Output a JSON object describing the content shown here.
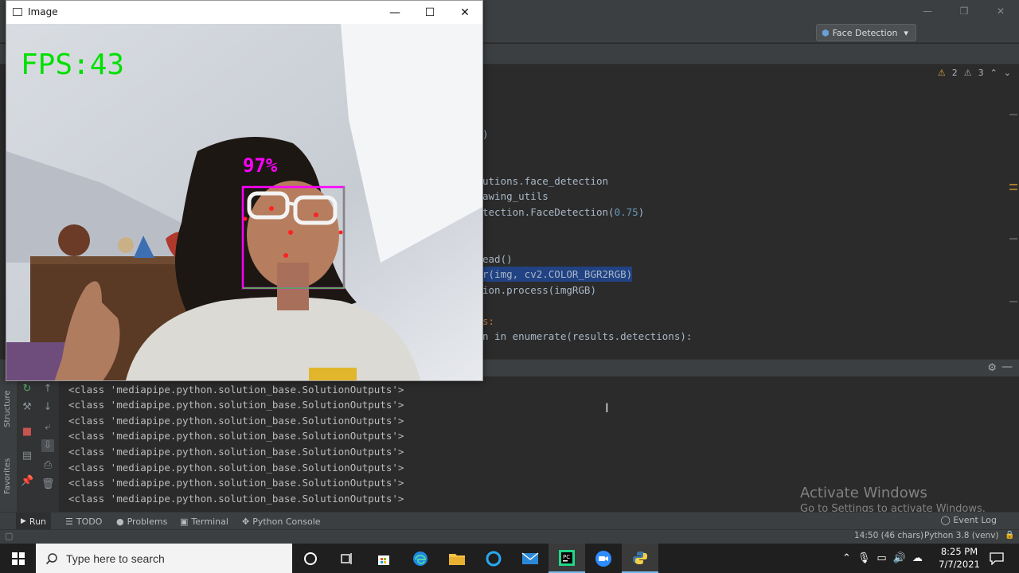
{
  "opencv_window": {
    "title": "Image",
    "fps_label": "FPS:43",
    "confidence_label": "97%",
    "controls": {
      "minimize": "—",
      "maximize": "☐",
      "close": "✕"
    }
  },
  "ide": {
    "run_config": "Face Detection",
    "inspections": {
      "warnings": "2",
      "weak_warnings": "3"
    },
    "code_lines": [
      {
        "text": ")",
        "highlight": false
      },
      {
        "text": "utions.face_detection",
        "highlight": false
      },
      {
        "text": "awing_utils",
        "highlight": false
      },
      {
        "text": "tection.FaceDetection(",
        "number": "0.75",
        "tail": ")",
        "highlight": false
      },
      {
        "text": "ead()",
        "highlight": false
      },
      {
        "text": "r(img, cv2.COLOR_BGR2RGB)",
        "highlight": true
      },
      {
        "text": "ion.process(imgRGB)",
        "highlight": false
      },
      {
        "text": "s:",
        "highlight": false
      },
      {
        "text": "n in enumerate(results.detections):",
        "highlight": false
      }
    ],
    "console_lines": [
      "<class 'mediapipe.python.solution_base.SolutionOutputs'>",
      "<class 'mediapipe.python.solution_base.SolutionOutputs'>",
      "<class 'mediapipe.python.solution_base.SolutionOutputs'>",
      "<class 'mediapipe.python.solution_base.SolutionOutputs'>",
      "<class 'mediapipe.python.solution_base.SolutionOutputs'>",
      "<class 'mediapipe.python.solution_base.SolutionOutputs'>",
      "<class 'mediapipe.python.solution_base.SolutionOutputs'>",
      "<class 'mediapipe.python.solution_base.SolutionOutputs'>"
    ],
    "activation": {
      "title": "Activate Windows",
      "subtitle": "Go to Settings to activate Windows."
    },
    "side_labels": {
      "structure": "Structure",
      "favorites": "Favorites"
    },
    "tool_tabs": {
      "run": "Run",
      "todo": "TODO",
      "problems": "Problems",
      "terminal": "Terminal",
      "python_console": "Python Console",
      "event_log": "Event Log"
    },
    "status": {
      "position": "14:50 (46 chars)",
      "interpreter": "Python 3.8 (venv)"
    }
  },
  "taskbar": {
    "search_placeholder": "Type here to search",
    "time": "8:25 PM",
    "date": "7/7/2021"
  }
}
